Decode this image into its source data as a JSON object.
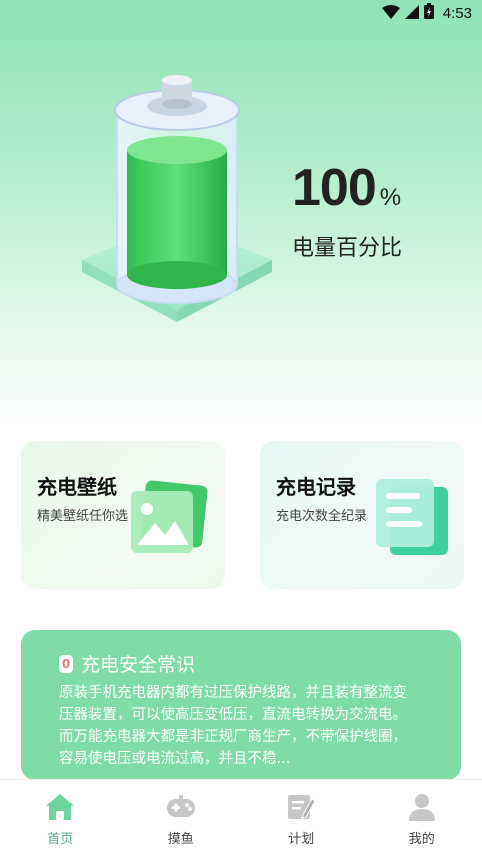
{
  "status_bar": {
    "time": "4:53",
    "icons": [
      "wifi-icon",
      "signal-icon",
      "battery-charging-icon"
    ]
  },
  "battery": {
    "percent_value": "100",
    "percent_unit": "%",
    "label": "电量百分比",
    "level": 1.0
  },
  "cards": [
    {
      "title": "充电壁纸",
      "subtitle": "精美壁纸任你选",
      "icon": "image-gallery-icon"
    },
    {
      "title": "充电记录",
      "subtitle": "充电次数全纪录",
      "icon": "document-list-icon"
    }
  ],
  "tips": {
    "badge": "0",
    "title": "充电安全常识",
    "body": "原装手机充电器内都有过压保护线路，并且装有整流变压器装置，可以使高压变低压，直流电转换为交流电。而万能充电器大都是非正规厂商生产，不带保护线圈，容易使电压或电流过高，并且不稳..."
  },
  "tab_bar": {
    "items": [
      {
        "label": "首页",
        "icon": "home-icon",
        "active": true
      },
      {
        "label": "摸鱼",
        "icon": "gamepad-icon",
        "active": false
      },
      {
        "label": "计划",
        "icon": "edit-note-icon",
        "active": false
      },
      {
        "label": "我的",
        "icon": "user-icon",
        "active": false
      }
    ]
  },
  "colors": {
    "accent": "#7fdca6",
    "battery_green": "#3cc55a",
    "active_tab": "#5aa884"
  }
}
